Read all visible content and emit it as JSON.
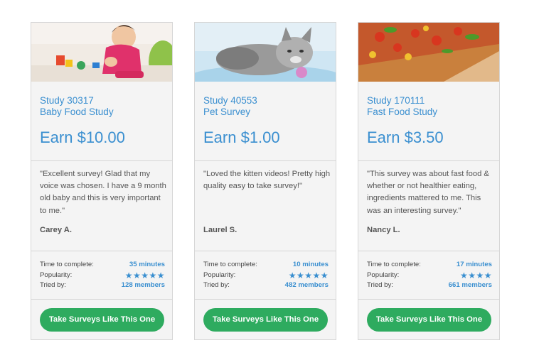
{
  "cards": [
    {
      "image_alt": "baby playing with toys",
      "study_id": "Study 30317",
      "study_name": "Baby Food Study",
      "earn": "Earn $10.00",
      "quote": "\"Excellent survey! Glad that my voice was chosen. I have a 9 month old baby and this is very important to me.\"",
      "author": "Carey A.",
      "labels": {
        "time": "Time to complete:",
        "popularity": "Popularity:",
        "tried": "Tried by:"
      },
      "time": "35 minutes",
      "stars": "★★★★★",
      "star_count": 5,
      "tried": "128 members",
      "cta": "Take Surveys Like This One"
    },
    {
      "image_alt": "grey kitten",
      "study_id": "Study 40553",
      "study_name": "Pet Survey",
      "earn": "Earn $1.00",
      "quote": "\"Loved the kitten videos! Pretty high quality easy to take survey!\"",
      "author": "Laurel S.",
      "labels": {
        "time": "Time to complete:",
        "popularity": "Popularity:",
        "tried": "Tried by:"
      },
      "time": "10 minutes",
      "stars": "★★★★★",
      "star_count": 5,
      "tried": "482 members",
      "cta": "Take Surveys Like This One"
    },
    {
      "image_alt": "pizza",
      "study_id": "Study 170111",
      "study_name": "Fast Food Study",
      "earn": "Earn $3.50",
      "quote": "\"This survey was about fast food & whether or not healthier eating, ingredients mattered to me. This was an interesting survey.\"",
      "author": "Nancy L.",
      "labels": {
        "time": "Time to complete:",
        "popularity": "Popularity:",
        "tried": "Tried by:"
      },
      "time": "17 minutes",
      "stars": "★★★★",
      "star_count": 4,
      "tried": "661 members",
      "cta": "Take Surveys Like This One"
    }
  ],
  "colors": {
    "accent": "#3a8fd0",
    "cta": "#2eab5f",
    "card_bg": "#f4f4f4",
    "border": "#d6d6d6"
  }
}
